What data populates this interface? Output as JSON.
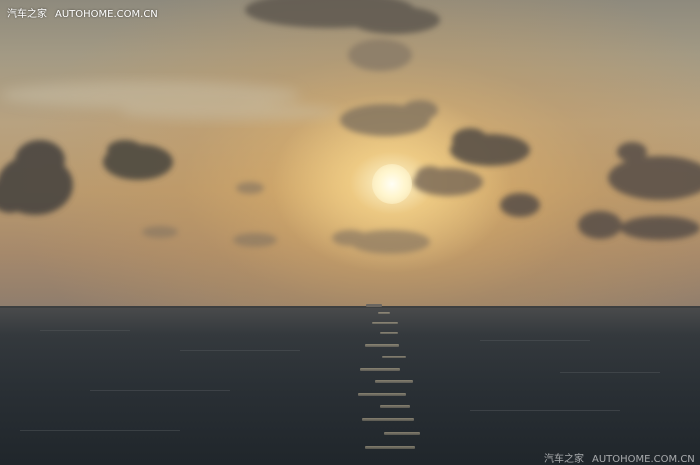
{
  "watermark_top": {
    "brand": "汽车之家",
    "site": "AUTOHOME.COM.CN"
  },
  "watermark_bottom": {
    "brand": "汽车之家",
    "site": "AUTOHOME.COM.CN"
  },
  "colors": {
    "sky_top": "#8e8a7d",
    "sky_glow": "#e8c07a",
    "sun": "#fff6cf",
    "sea": "#2a3035",
    "cloud": "#5e564c"
  }
}
